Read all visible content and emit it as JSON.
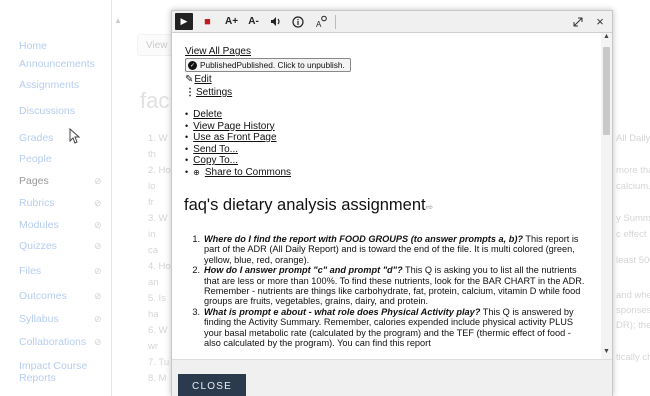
{
  "background": {
    "nav_items": [
      {
        "label": "Home",
        "eye": ""
      },
      {
        "label": "Announcements",
        "eye": ""
      },
      {
        "label": "Assignments",
        "eye": ""
      },
      {
        "label": "Discussions",
        "eye": ""
      },
      {
        "label": "Grades",
        "eye": ""
      },
      {
        "label": "People",
        "eye": ""
      },
      {
        "label": "Pages",
        "eye": "⊘"
      },
      {
        "label": "Rubrics",
        "eye": "⊘"
      },
      {
        "label": "Modules",
        "eye": "⊘"
      },
      {
        "label": "Quizzes",
        "eye": "⊘"
      },
      {
        "label": "Files",
        "eye": "⊘"
      },
      {
        "label": "Outcomes",
        "eye": "⊘"
      },
      {
        "label": "Syllabus",
        "eye": "⊘"
      },
      {
        "label": "Collaborations",
        "eye": "⊘"
      },
      {
        "label": "Impact Course Reports",
        "eye": ""
      }
    ],
    "view_button": "View",
    "title_fragment": "fac",
    "left_fragments": [
      "1. W",
      "th",
      "2. Ho",
      "lo",
      "fr",
      "3. W",
      "in",
      "ca",
      "4. Ho",
      "an",
      "5. Is",
      "ha",
      "6. W",
      "wr",
      "7. Tu",
      "8. M"
    ],
    "right_fragments": [
      "All Daily F",
      "more tha",
      "calcium, v",
      "y Summa",
      "c effect",
      "least 500",
      "and whe",
      "sponses.",
      "DR); the c",
      "tically ch"
    ]
  },
  "toolbar": {
    "play": "▶",
    "stop": "■",
    "font_up": "A+",
    "font_down": "A-",
    "volume": "🔊",
    "info": "ⓘ",
    "settings": "A͡ᵃ",
    "expand": "⤢",
    "close": "×"
  },
  "page": {
    "view_all": "View All Pages",
    "published_text": "PublishedPublished. Click to unpublish.",
    "edit": "Edit",
    "settings": " Settings",
    "actions": [
      "Delete",
      "View Page History",
      "Use as Front Page",
      "Send To...",
      "Copy To...",
      "Share to Commons"
    ],
    "title": "faq's dietary analysis assignment",
    "questions": [
      {
        "num": "1.",
        "q": "Where do I find the report with FOOD GROUPS (to answer prompts a, b)?",
        "a": " This report is part of the ADR (All Daily Report) and is toward the end of the file.  It is multi colored (green, yellow, blue, red, orange)."
      },
      {
        "num": "2.",
        "q": "How do I answer prompt \"c\" and prompt \"d\"?",
        "a": "  This Q is asking you to list all the nutrients that are less or more than 100%.  To find these nutrients, look for the BAR CHART in the ADR.  Remember - nutrients are things like carbohydrate, fat, protein, calcium, vitamin D while food groups are fruits, vegetables, grains, dairy, and protein."
      },
      {
        "num": "3.",
        "q": "What is prompt e about - what role does Physical Activity play?",
        "a": "  This Q is answered by finding the Activity Summary.  Remember, calories expended include physical activity PLUS your basal metabolic rate (calculated by the program) and the TEF (thermic effect of food - also calculated by the program).  You can find this report"
      }
    ]
  },
  "footer": {
    "close": "CLOSE"
  }
}
